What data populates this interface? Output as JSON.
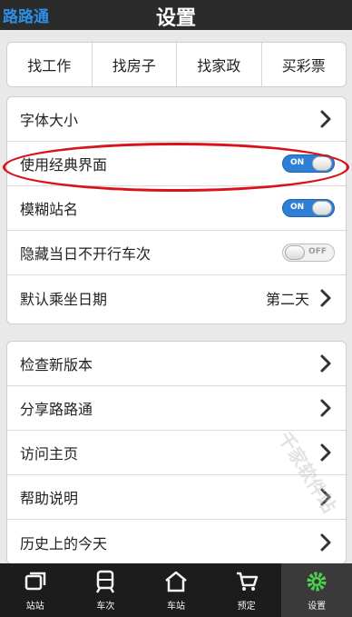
{
  "app": {
    "back_label": "路路通",
    "title": "设置"
  },
  "quick_links": [
    "找工作",
    "找房子",
    "找家政",
    "买彩票"
  ],
  "settings_group1": [
    {
      "label": "字体大小",
      "type": "chevron"
    },
    {
      "label": "使用经典界面",
      "type": "toggle",
      "state": "ON"
    },
    {
      "label": "模糊站名",
      "type": "toggle",
      "state": "ON"
    },
    {
      "label": "隐藏当日不开行车次",
      "type": "toggle",
      "state": "OFF"
    },
    {
      "label": "默认乘坐日期",
      "type": "chevron",
      "value": "第二天"
    }
  ],
  "settings_group2": [
    {
      "label": "检查新版本"
    },
    {
      "label": "分享路路通"
    },
    {
      "label": "访问主页"
    },
    {
      "label": "帮助说明"
    },
    {
      "label": "历史上的今天"
    }
  ],
  "tabs": [
    {
      "label": "站站",
      "icon": "stations-icon"
    },
    {
      "label": "车次",
      "icon": "train-icon"
    },
    {
      "label": "车站",
      "icon": "station-house-icon"
    },
    {
      "label": "预定",
      "icon": "cart-icon"
    },
    {
      "label": "设置",
      "icon": "gear-icon",
      "active": true
    }
  ],
  "watermark": "千家软件站",
  "colors": {
    "accent": "#2d8ee6",
    "toggle_on": "#2f7fd6",
    "highlight": "#d7141b",
    "tabbar": "#1c1c1c"
  }
}
